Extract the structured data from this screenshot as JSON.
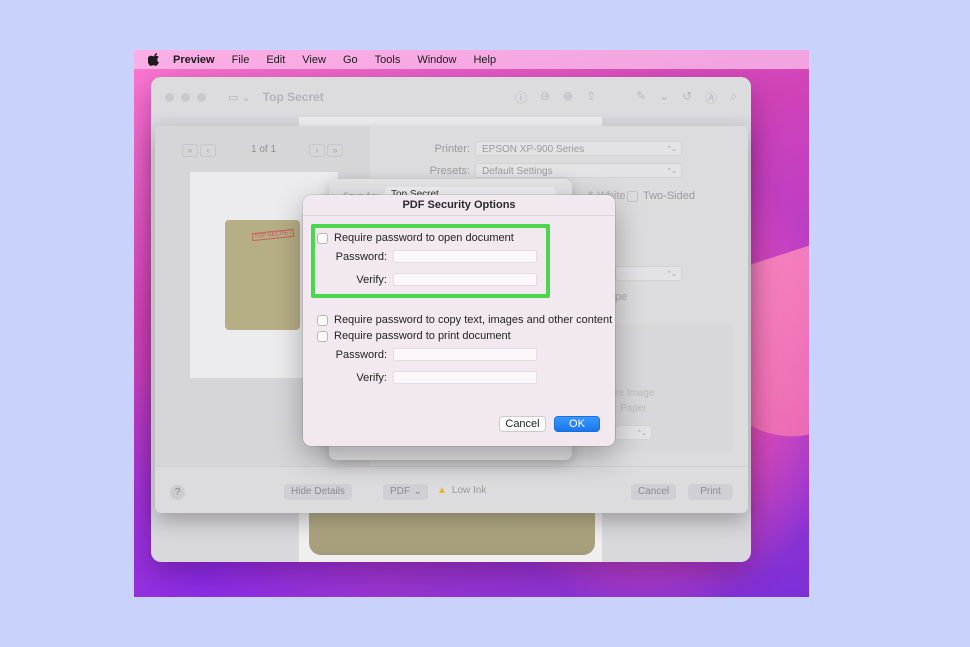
{
  "menubar": {
    "app": "Preview",
    "items": [
      "File",
      "Edit",
      "View",
      "Go",
      "Tools",
      "Window",
      "Help"
    ]
  },
  "preview_window": {
    "title": "Top Secret"
  },
  "print_panel": {
    "page_indicator": "1 of 1",
    "printer_label": "Printer:",
    "printer_value": "EPSON XP-900 Series",
    "presets_label": "Presets:",
    "presets_value": "Default Settings",
    "two_sided": "Two-Sided",
    "bw_fragment": "& White",
    "orientation_fragment": "pe",
    "image_fragment": "re Image",
    "paper_fragment": "Paper",
    "thumbnail_stamp": "TOP SECRET",
    "help": "?",
    "hide_details": "Hide Details",
    "pdf_menu": "PDF",
    "low_ink": "Low Ink",
    "cancel": "Cancel",
    "print": "Print"
  },
  "save_sheet": {
    "save_as_label": "Save As:",
    "save_as_value": "Top Secret"
  },
  "dialog": {
    "title": "PDF Security Options",
    "open_doc_check": "Require password to open document",
    "copy_check": "Require password to copy text, images and other content",
    "print_check": "Require password to print document",
    "password_label": "Password:",
    "verify_label": "Verify:",
    "cancel": "Cancel",
    "ok": "OK"
  },
  "colors": {
    "highlight": "#4cd64e",
    "ok_button": "#1a76ee"
  }
}
